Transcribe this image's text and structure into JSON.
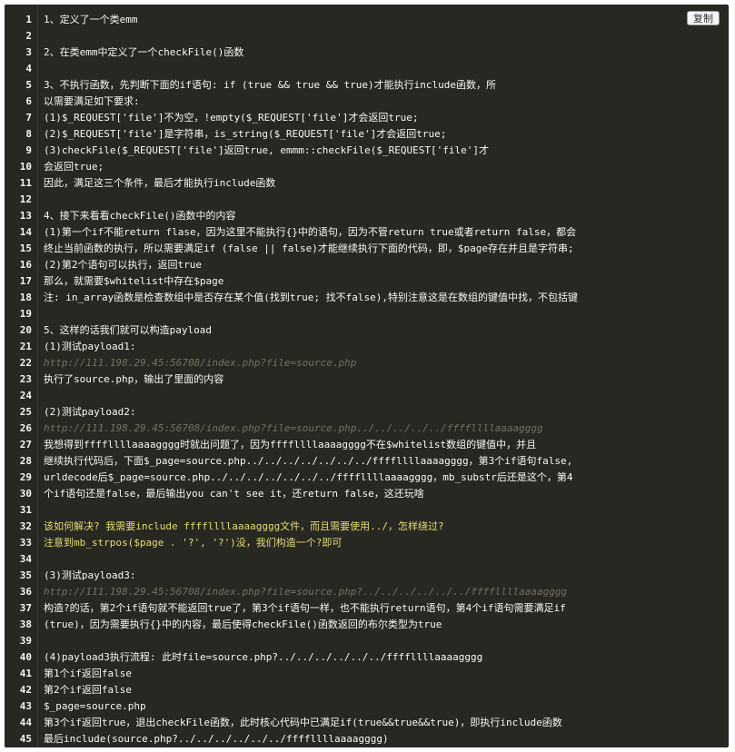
{
  "toolbar": {
    "copy_label": "复制"
  },
  "lines": [
    {
      "n": "1",
      "text": "1、定义了一个类emm",
      "color": "#f8f8f2"
    },
    {
      "n": "2",
      "text": "",
      "color": "#f8f8f2"
    },
    {
      "n": "3",
      "text": "2、在类emm中定义了一个checkFile()函数",
      "color": "#f8f8f2"
    },
    {
      "n": "4",
      "text": "",
      "color": "#f8f8f2"
    },
    {
      "n": "5",
      "text": "3、不执行函数，先判断下面的if语句: if (true && true && true)才能执行include函数，所",
      "color": "#f8f8f2"
    },
    {
      "n": "6",
      "text": "以需要满足如下要求:",
      "color": "#f8f8f2"
    },
    {
      "n": "7",
      "text": "(1)$_REQUEST['file']不为空，!empty($_REQUEST['file']才会返回true;",
      "color": "#f8f8f2"
    },
    {
      "n": "8",
      "text": "(2)$_REQUEST['file']是字符串，is_string($_REQUEST['file']才会返回true;",
      "color": "#f8f8f2"
    },
    {
      "n": "9",
      "text": "(3)checkFile($_REQUEST['file']返回true, emmm::checkFile($_REQUEST['file']才",
      "color": "#f8f8f2"
    },
    {
      "n": "10",
      "text": "会返回true;",
      "color": "#f8f8f2"
    },
    {
      "n": "11",
      "text": "因此，满足这三个条件，最后才能执行include函数",
      "color": "#f8f8f2"
    },
    {
      "n": "12",
      "text": "",
      "color": "#f8f8f2"
    },
    {
      "n": "13",
      "text": "4、接下来看看checkFile()函数中的内容",
      "color": "#f8f8f2"
    },
    {
      "n": "14",
      "text": "(1)第一个if不能return flase，因为这里不能执行{}中的语句，因为不管return true或者return false，都会",
      "color": "#f8f8f2"
    },
    {
      "n": "15",
      "text": "终止当前函数的执行，所以需要满足if (false || false)才能继续执行下面的代码，即，$page存在并且是字符串;",
      "color": "#f8f8f2"
    },
    {
      "n": "16",
      "text": "(2)第2个语句可以执行，返回true",
      "color": "#f8f8f2"
    },
    {
      "n": "17",
      "text": "那么，就需要$whitelist中存在$page",
      "color": "#f8f8f2"
    },
    {
      "n": "18",
      "text": "注: in_array函数是检查数组中是否存在某个值(找到true; 找不false),特别注意这是在数组的键值中找，不包括键",
      "color": "#f8f8f2"
    },
    {
      "n": "19",
      "text": "",
      "color": "#f8f8f2"
    },
    {
      "n": "20",
      "text": "5、这样的话我们就可以构造payload",
      "color": "#f8f8f2"
    },
    {
      "n": "21",
      "text": "(1)测试payload1:",
      "color": "#f8f8f2"
    },
    {
      "n": "22",
      "text": "http://111.198.29.45:56708/index.php?file=source.php",
      "color": "#75715e"
    },
    {
      "n": "23",
      "text": "执行了source.php，输出了里面的内容",
      "color": "#f8f8f2"
    },
    {
      "n": "24",
      "text": "",
      "color": "#f8f8f2"
    },
    {
      "n": "25",
      "text": "(2)测试payload2:",
      "color": "#f8f8f2"
    },
    {
      "n": "26",
      "text": "http://111.198.29.45:56708/index.php?file=source.php../../../../../ffffllllaaaagggg",
      "color": "#75715e"
    },
    {
      "n": "27",
      "text": "我想得到ffffllllaaaagggg时就出问题了，因为ffffllllaaaagggg不在$whitelist数组的键值中，并且",
      "color": "#f8f8f2"
    },
    {
      "n": "28",
      "text": "继续执行代码后，下面$_page=source.php../../../../../../../ffffllllaaaagggg，第3个if语句false,",
      "color": "#f8f8f2"
    },
    {
      "n": "29",
      "text": "urldecode后$_page=source.php../../../../../../../ffffllllaaaagggg，mb_substr后还是这个，第4",
      "color": "#f8f8f2"
    },
    {
      "n": "30",
      "text": "个if语句还是false，最后输出you can't see it，还return false，这还玩啥",
      "color": "#f8f8f2"
    },
    {
      "n": "31",
      "text": "",
      "color": "#f8f8f2"
    },
    {
      "n": "32",
      "text": "该如何解决? 我需要include ffffllllaaaagggg文件，而且需要使用../，怎样绕过?",
      "color": "#e6db74"
    },
    {
      "n": "33",
      "text": "注意到mb_strpos($page . '?', '?')没，我们构造一个?即可",
      "color": "#e6db74"
    },
    {
      "n": "34",
      "text": "",
      "color": "#f8f8f2"
    },
    {
      "n": "35",
      "text": "(3)测试payload3:",
      "color": "#f8f8f2"
    },
    {
      "n": "36",
      "text": "http://111.198.29.45:56708/index.php?file=source.php?../../../../../../ffffllllaaaagggg",
      "color": "#75715e"
    },
    {
      "n": "37",
      "text": "构造?的话，第2个if语句就不能返回true了，第3个if语句一样，也不能执行return语句，第4个if语句需要满足if",
      "color": "#f8f8f2"
    },
    {
      "n": "38",
      "text": "(true)，因为需要执行{}中的内容，最后使得checkFile()函数返回的布尔类型为true",
      "color": "#f8f8f2"
    },
    {
      "n": "39",
      "text": "",
      "color": "#f8f8f2"
    },
    {
      "n": "40",
      "text": "(4)payload3执行流程: 此时file=source.php?../../../../../../ffffllllaaaagggg",
      "color": "#f8f8f2"
    },
    {
      "n": "41",
      "text": "第1个if返回false",
      "color": "#f8f8f2"
    },
    {
      "n": "42",
      "text": "第2个if返回false",
      "color": "#f8f8f2"
    },
    {
      "n": "43",
      "text": "$_page=source.php",
      "color": "#f8f8f2"
    },
    {
      "n": "44",
      "text": "第3个if返回true，退出checkFile函数，此时核心代码中已满足if(true&&true&&true)，即执行include函数",
      "color": "#f8f8f2"
    },
    {
      "n": "45",
      "text": "最后include(source.php?../../../../../../ffffllllaaaagggg)",
      "color": "#f8f8f2"
    }
  ]
}
